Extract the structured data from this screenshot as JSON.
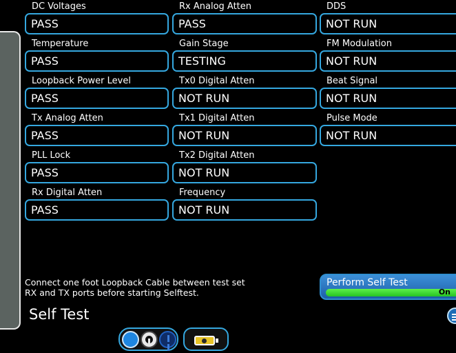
{
  "columns": [
    [
      {
        "label": "DC Voltages",
        "value": "PASS"
      },
      {
        "label": "Temperature",
        "value": "PASS"
      },
      {
        "label": "Loopback Power Level",
        "value": "PASS"
      },
      {
        "label": "Tx Analog Atten",
        "value": "PASS"
      },
      {
        "label": "PLL Lock",
        "value": "PASS"
      },
      {
        "label": "Rx Digital Atten",
        "value": "PASS"
      }
    ],
    [
      {
        "label": "Rx Analog Atten",
        "value": "PASS"
      },
      {
        "label": "Gain Stage",
        "value": "TESTING"
      },
      {
        "label": "Tx0 Digital Atten",
        "value": "NOT RUN"
      },
      {
        "label": "Tx1 Digital Atten",
        "value": "NOT RUN"
      },
      {
        "label": "Tx2 Digital Atten",
        "value": "NOT RUN"
      },
      {
        "label": "Frequency",
        "value": "NOT RUN"
      }
    ],
    [
      {
        "label": "DDS",
        "value": "NOT RUN"
      },
      {
        "label": "FM Modulation",
        "value": "NOT RUN"
      },
      {
        "label": "Beat Signal",
        "value": "NOT RUN"
      },
      {
        "label": "Pulse Mode",
        "value": "NOT RUN"
      }
    ]
  ],
  "message": {
    "line1": "Connect one foot Loopback Cable between test set",
    "line2": "RX and TX ports before starting Selftest."
  },
  "page_title": "Self Test",
  "perform_self_test": {
    "label": "Perform Self Test",
    "state": "On"
  },
  "icons": {
    "corner": "menu-icon",
    "nav": [
      "status-circle-icon",
      "key-icon",
      "alert-icon"
    ],
    "battery": "battery-icon"
  },
  "colors": {
    "accent": "#35a8e0",
    "toggle_on": "#3fd93a",
    "button_blue": "#2a7fd0"
  }
}
